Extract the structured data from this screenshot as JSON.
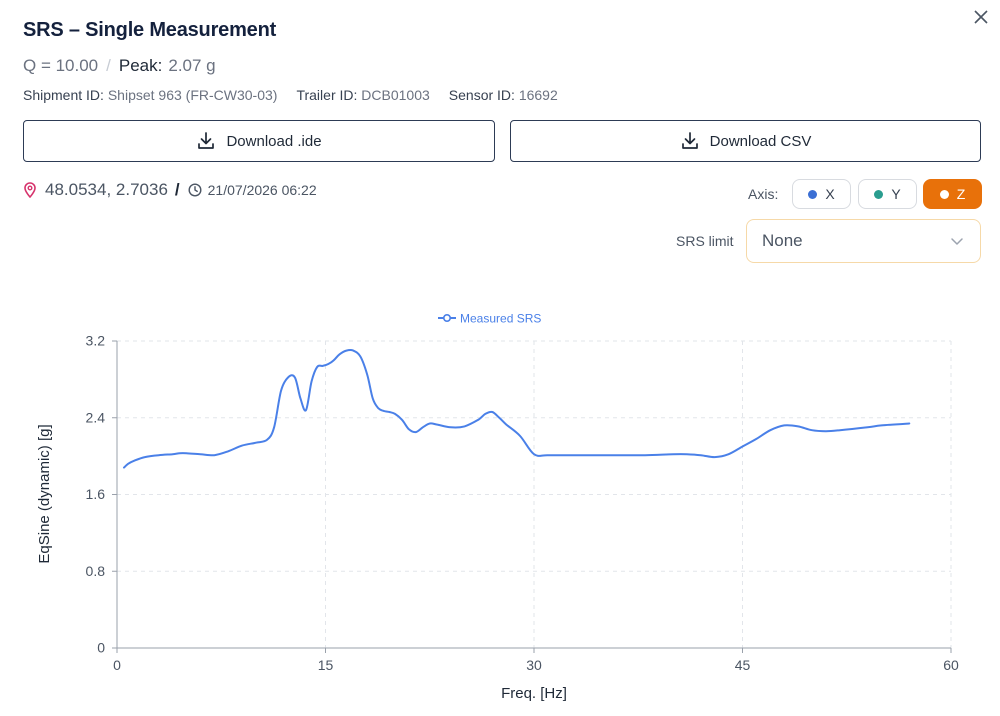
{
  "dialog": {
    "title": "SRS – Single Measurement",
    "q_text": "Q = 10.00",
    "separator": "/",
    "peak_label": "Peak:",
    "peak_value": "2.07 g"
  },
  "ids": {
    "shipment_label": "Shipment ID:",
    "shipment_value": "Shipset 963 (FR-CW30-03)",
    "trailer_label": "Trailer ID:",
    "trailer_value": "DCB01003",
    "sensor_label": "Sensor ID:",
    "sensor_value": "16692"
  },
  "buttons": {
    "download_ide": "Download .ide",
    "download_csv": "Download CSV"
  },
  "location": {
    "coords": "48.0534, 2.7036",
    "slash": "/",
    "timestamp": "21/07/2026 06:22"
  },
  "axis": {
    "label": "Axis:",
    "options": [
      {
        "label": "X",
        "color": "#3b6fd4",
        "selected": false
      },
      {
        "label": "Y",
        "color": "#2a9d8f",
        "selected": false
      },
      {
        "label": "Z",
        "color": "#ffffff",
        "selected": true
      }
    ],
    "selected_color": "#e8710a"
  },
  "srs_limit": {
    "label": "SRS limit",
    "selected": "None"
  },
  "chart_data": {
    "type": "line",
    "legend": "Measured SRS",
    "legend_position": "top-center",
    "xlabel": "Freq. [Hz]",
    "ylabel": "EqSine (dynamic) [g]",
    "xlim": [
      0,
      60
    ],
    "ylim": [
      0,
      3.2
    ],
    "xticks": [
      0,
      15,
      30,
      45,
      60
    ],
    "yticks": [
      0,
      0.8,
      1.6,
      2.4,
      3.2
    ],
    "grid": true,
    "color": "#4a80e8",
    "series": [
      {
        "name": "Measured SRS",
        "x": [
          0.5,
          0.8,
          1.2,
          2,
          3,
          4,
          4.5,
          5,
          6,
          7,
          8,
          9,
          10,
          10.8,
          11.3,
          11.8,
          12.3,
          12.8,
          13.2,
          13.6,
          14.0,
          14.4,
          14.8,
          15.2,
          15.6,
          16.0,
          16.5,
          17.0,
          17.5,
          18.0,
          18.4,
          18.8,
          19.2,
          19.6,
          20.0,
          20.5,
          21.0,
          21.5,
          22.0,
          22.5,
          23.0,
          24.0,
          25.0,
          26.0,
          26.5,
          27.0,
          27.5,
          28.0,
          29.0,
          30.0,
          31.0,
          33.0,
          36.0,
          38.0,
          40.0,
          41.0,
          42.0,
          43.0,
          44.0,
          45.0,
          46.0,
          47.0,
          48.0,
          49.0,
          50.0,
          51.0,
          52.0,
          54.0,
          55.0,
          57.0
        ],
        "y": [
          1.88,
          1.92,
          1.95,
          1.99,
          2.01,
          2.02,
          2.03,
          2.03,
          2.02,
          2.01,
          2.05,
          2.11,
          2.14,
          2.17,
          2.3,
          2.68,
          2.82,
          2.82,
          2.6,
          2.48,
          2.78,
          2.93,
          2.94,
          2.96,
          3.0,
          3.06,
          3.1,
          3.1,
          3.04,
          2.85,
          2.6,
          2.5,
          2.47,
          2.46,
          2.44,
          2.38,
          2.28,
          2.25,
          2.3,
          2.34,
          2.33,
          2.3,
          2.31,
          2.38,
          2.44,
          2.46,
          2.4,
          2.33,
          2.21,
          2.02,
          2.01,
          2.01,
          2.01,
          2.01,
          2.02,
          2.02,
          2.01,
          1.99,
          2.02,
          2.1,
          2.18,
          2.27,
          2.32,
          2.31,
          2.27,
          2.26,
          2.27,
          2.3,
          2.32,
          2.34
        ]
      }
    ]
  }
}
